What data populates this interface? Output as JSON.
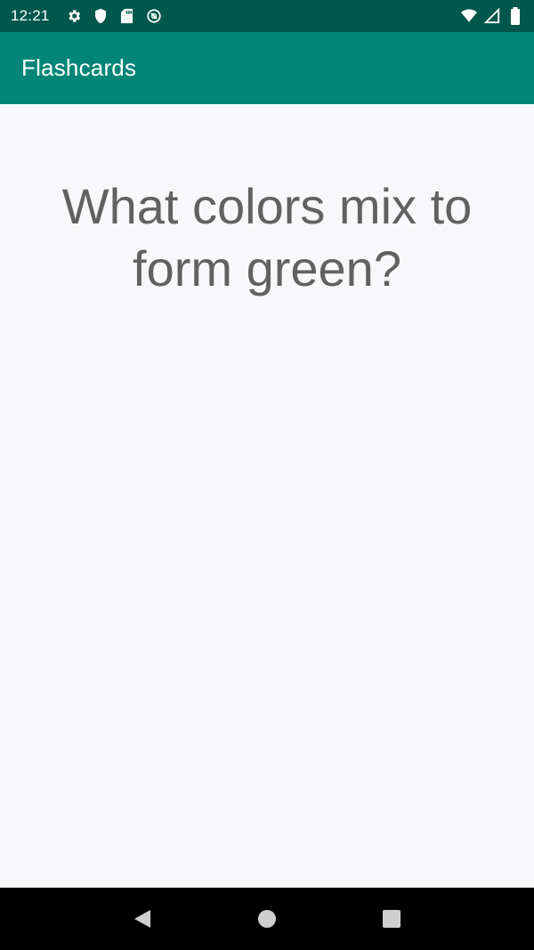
{
  "status_bar": {
    "time": "12:21",
    "left_icons": [
      "gear-icon",
      "shield-icon",
      "sd-card-icon",
      "no-sync-icon"
    ],
    "right_icons": [
      "wifi-icon",
      "cell-signal-icon",
      "battery-icon"
    ]
  },
  "app_bar": {
    "title": "Flashcards"
  },
  "card": {
    "question": "What colors mix to form green?"
  },
  "nav_bar": {
    "buttons": [
      "back-icon",
      "home-icon",
      "recents-icon"
    ]
  },
  "colors": {
    "status_bar": "#00574b",
    "app_bar": "#008577",
    "question_text": "#616161",
    "background": "#f8f8fb"
  }
}
